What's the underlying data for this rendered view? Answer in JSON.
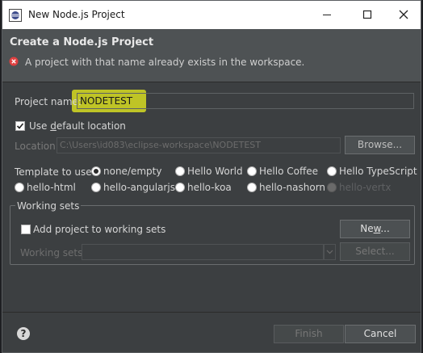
{
  "window": {
    "title": "New Node.js Project"
  },
  "header": {
    "title": "Create a Node.js Project",
    "error_message": "A project with that name already exists in the workspace."
  },
  "project_name": {
    "label": "Project name:",
    "value": "NODETEST"
  },
  "default_location": {
    "label_prefix": "Use ",
    "label_mnemonic": "d",
    "label_rest": "efault location",
    "checked": true
  },
  "location": {
    "label": "Location:",
    "value": "C:\\Users\\id083\\eclipse-workspace\\NODETEST",
    "browse": "Browse..."
  },
  "template": {
    "label": "Template to use:",
    "options": [
      "none/empty",
      "Hello World",
      "Hello Coffee",
      "Hello TypeScript",
      "hello-html",
      "hello-angularjs",
      "hello-koa",
      "hello-nashorn",
      "hello-vertx"
    ],
    "selected": "none/empty"
  },
  "working_sets": {
    "legend": "Working sets",
    "add_label": "Add project to working sets",
    "new_button_prefix": "Ne",
    "new_button_mnemonic": "w",
    "new_button_rest": "...",
    "sets_label": "Working sets:",
    "select_button": "Select..."
  },
  "footer": {
    "finish": "Finish",
    "cancel": "Cancel"
  },
  "colors": {
    "highlight": "#d6dc22",
    "error": "#e04040",
    "background": "#3c3f41"
  }
}
